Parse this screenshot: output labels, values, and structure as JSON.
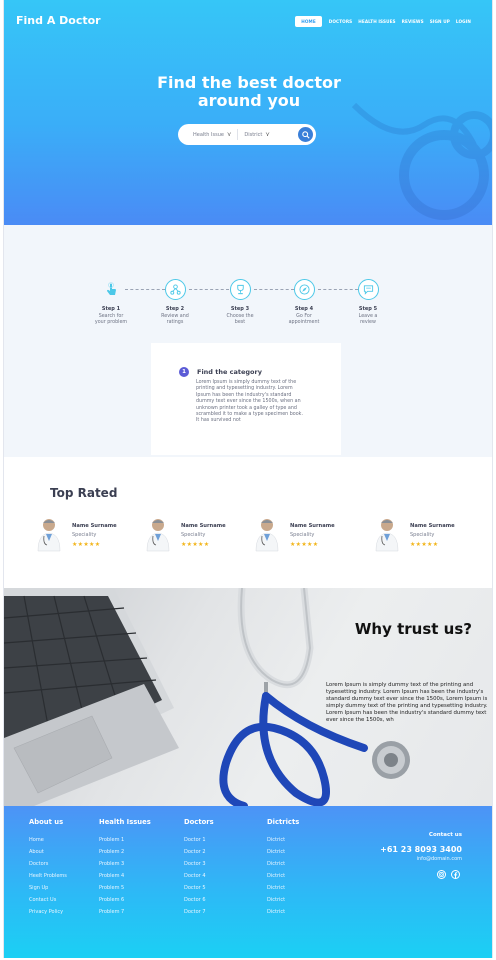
{
  "header": {
    "brand": "Find A Doctor",
    "nav": [
      "HOME",
      "DOCTORS",
      "HEALTH ISSUES",
      "REVIEWS",
      "SIGN UP",
      "LOGIN"
    ]
  },
  "hero": {
    "title_line1": "Find the best doctor",
    "title_line2": "around you",
    "search": {
      "health_issue_label": "Health Issue",
      "district_label": "District"
    }
  },
  "steps": [
    {
      "title": "Step 1",
      "desc_line1": "Search for",
      "desc_line2": "your problem",
      "icon": "pointer-icon"
    },
    {
      "title": "Step 2",
      "desc_line1": "Review and",
      "desc_line2": "ratings",
      "icon": "network-icon"
    },
    {
      "title": "Step 3",
      "desc_line1": "Choose the",
      "desc_line2": "best",
      "icon": "trophy-icon"
    },
    {
      "title": "Step 4",
      "desc_line1": "Go For",
      "desc_line2": "appointment",
      "icon": "compass-icon"
    },
    {
      "title": "Step 5",
      "desc_line1": "Leave a",
      "desc_line2": "review",
      "icon": "chat-icon"
    }
  ],
  "category": {
    "number": "1",
    "title": "Find the category",
    "text": "Lorem Ipsum is simply dummy text of the printing and typesetting industry. Lorem Ipsum has been the industry's standard dummy text ever since the 1500s, when an unknown printer took a galley of type and scrambled it to make a type specimen book. It has survived not"
  },
  "top_rated": {
    "heading": "Top Rated",
    "doctors": [
      {
        "name": "Name Surname",
        "speciality": "Speciality",
        "stars": "★★★★★"
      },
      {
        "name": "Name Surname",
        "speciality": "Speciality",
        "stars": "★★★★★"
      },
      {
        "name": "Name Surname",
        "speciality": "Speciality",
        "stars": "★★★★★"
      },
      {
        "name": "Name Surname",
        "speciality": "Speciality",
        "stars": "★★★★★"
      }
    ]
  },
  "trust": {
    "title": "Why trust us?",
    "text": "Lorem Ipsum is simply dummy text of the printing and typesetting industry. Lorem Ipsum has been the industry's standard dummy text ever since the 1500s, Lorem Ipsum is simply dummy text of the printing and typesetting industry. Lorem Ipsum has been the industry's standard dummy text ever since the 1500s, wh"
  },
  "footer": {
    "columns": [
      {
        "heading": "About us",
        "links": [
          "Home",
          "About",
          "Doctors",
          "Heelt Problems",
          "Sign Up",
          "Contact Us",
          "Privacy Policy"
        ]
      },
      {
        "heading": "Health Issues",
        "links": [
          "Problem 1",
          "Problem 2",
          "Problem 3",
          "Problem 4",
          "Problem 5",
          "Problem 6",
          "Problem 7"
        ]
      },
      {
        "heading": "Doctors",
        "links": [
          "Doctor 1",
          "Doctor 2",
          "Doctor 3",
          "Doctor 4",
          "Doctor 5",
          "Doctor 6",
          "Doctor 7"
        ]
      },
      {
        "heading": "Dictricts",
        "links": [
          "Dictrict",
          "Dictrict",
          "Dictrict",
          "Dictrict",
          "Dictrict",
          "Dictrict",
          "Dictrict"
        ]
      }
    ],
    "contact": {
      "title": "Contact us",
      "phone": "+61 23 8093 3400",
      "email": "info@domain.com"
    }
  },
  "colors": {
    "hero_top": "#36c6f7",
    "hero_bottom": "#4a8bf5",
    "accent": "#3a7fd8",
    "step_border": "#4cc8e8",
    "star": "#f2b51b",
    "footer_top": "#4d93f6",
    "footer_bottom": "#1bd0f4"
  }
}
